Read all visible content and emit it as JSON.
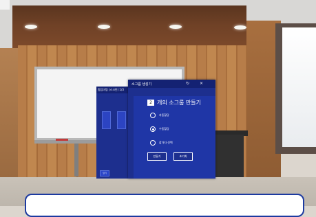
{
  "scene": {
    "background_color": "#dcd6ce",
    "accent_color": "#1d2f8e"
  },
  "back_panel": {
    "title": "협업미팅 (스크린) 1/3",
    "seats": [
      "",
      ""
    ],
    "button_label": "닫기"
  },
  "main_panel": {
    "title": "소그룹 생성기",
    "refresh_icon": "refresh-icon",
    "close_icon": "close-icon",
    "group_count": "2",
    "headline": "개의 소그룹 만들기",
    "options": [
      {
        "label": "자동할당",
        "selected": false
      },
      {
        "label": "수동할당",
        "selected": true
      },
      {
        "label": "참가자 선택",
        "selected": false
      }
    ],
    "create_label": "만들기",
    "cancel_label": "초기화"
  }
}
